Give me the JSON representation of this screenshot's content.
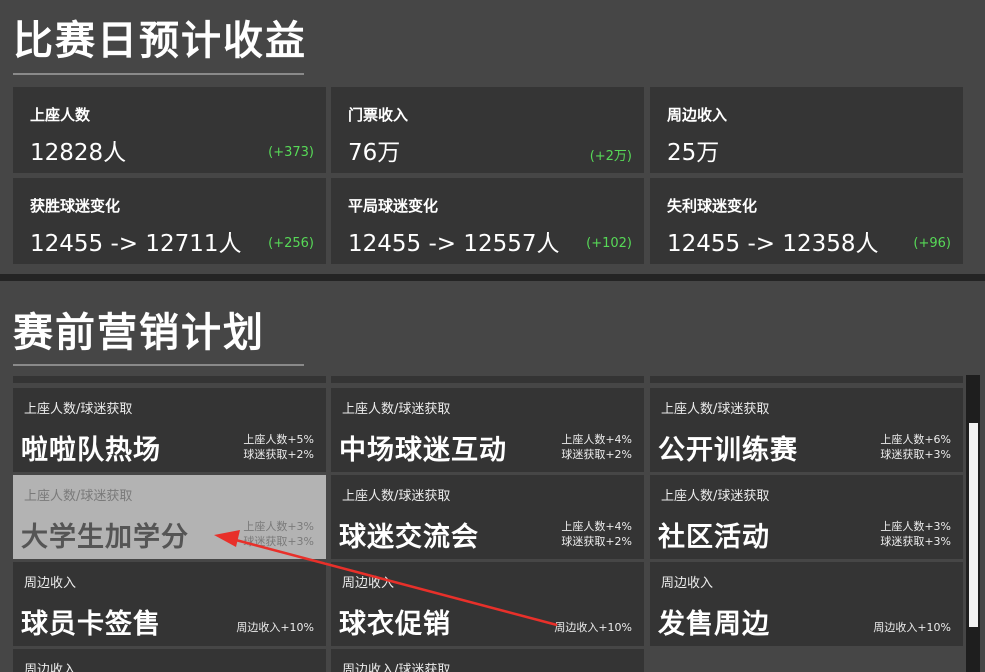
{
  "revenue": {
    "title": "比赛日预计收益",
    "stats": [
      {
        "label": "上座人数",
        "value": "12828人",
        "delta": "(+373)"
      },
      {
        "label": "门票收入",
        "value": "76万",
        "delta": "(+2万)"
      },
      {
        "label": "周边收入",
        "value": "25万",
        "delta": ""
      },
      {
        "label": "获胜球迷变化",
        "value": "12455 -> 12711人",
        "delta": "(+256)"
      },
      {
        "label": "平局球迷变化",
        "value": "12455 -> 12557人",
        "delta": "(+102)"
      },
      {
        "label": "失利球迷变化",
        "value": "12455 -> 12358人",
        "delta": "(+96)"
      }
    ]
  },
  "marketing": {
    "title": "赛前营销计划",
    "cards": [
      {
        "category": "上座人数/球迷获取",
        "name": "啦啦队热场",
        "effect1": "上座人数+5%",
        "effect2": "球迷获取+2%"
      },
      {
        "category": "上座人数/球迷获取",
        "name": "中场球迷互动",
        "effect1": "上座人数+4%",
        "effect2": "球迷获取+2%"
      },
      {
        "category": "上座人数/球迷获取",
        "name": "公开训练赛",
        "effect1": "上座人数+6%",
        "effect2": "球迷获取+3%"
      },
      {
        "category": "上座人数/球迷获取",
        "name": "大学生加学分",
        "effect1": "上座人数+3%",
        "effect2": "球迷获取+3%"
      },
      {
        "category": "上座人数/球迷获取",
        "name": "球迷交流会",
        "effect1": "上座人数+4%",
        "effect2": "球迷获取+2%"
      },
      {
        "category": "上座人数/球迷获取",
        "name": "社区活动",
        "effect1": "上座人数+3%",
        "effect2": "球迷获取+3%"
      },
      {
        "category": "周边收入",
        "name": "球员卡签售",
        "effect1": "周边收入+10%",
        "effect2": ""
      },
      {
        "category": "周边收入",
        "name": "球衣促销",
        "effect1": "周边收入+10%",
        "effect2": ""
      },
      {
        "category": "周边收入",
        "name": "发售周边",
        "effect1": "周边收入+10%",
        "effect2": ""
      },
      {
        "category": "周边收入",
        "name": "",
        "effect1": "",
        "effect2": ""
      },
      {
        "category": "周边收入/球迷获取",
        "name": "",
        "effect1": "",
        "effect2": ""
      }
    ]
  },
  "colors": {
    "positive_delta": "#57d957",
    "annotation_arrow": "#e8302a"
  }
}
